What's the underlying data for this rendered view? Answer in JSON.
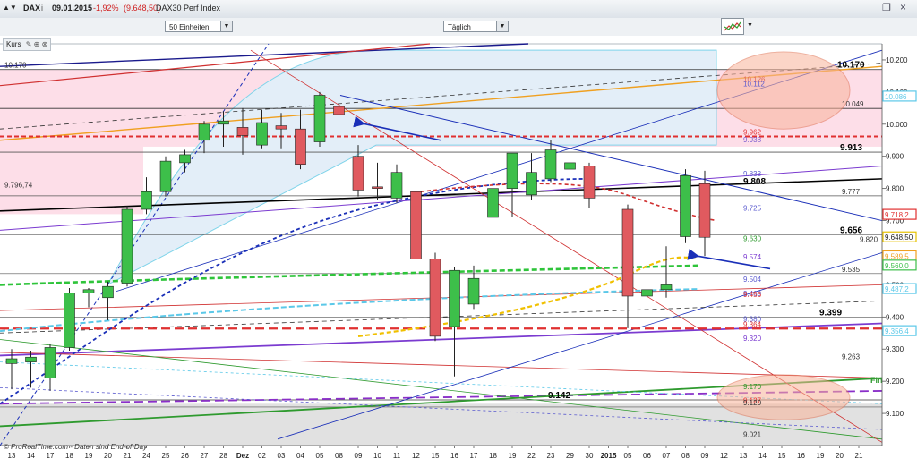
{
  "header": {
    "instrument_label": "DAX",
    "info_icon": "i",
    "date": "09.01.2015",
    "change": "-1,92%",
    "price": "(9.648,50)",
    "index_name": "DAX30 Perf Index"
  },
  "toolbar": {
    "units_select": "50 Einheiten",
    "interval_select": "Täglich",
    "panel_label": "Kurs"
  },
  "footer": {
    "copyright": "© ProRealTime.com - Daten sind End-of-Day"
  },
  "colors": {
    "bull": "#3dbf4a",
    "bear": "#e05a5f",
    "pink_zone": "#fcd3e0",
    "blue_zone": "#e3eef8",
    "ellipse": "#f9b49a"
  },
  "chart_data": {
    "type": "candlestick",
    "title": "DAX30 Perf Index",
    "ylim": [
      9000,
      10250
    ],
    "y_ticks": [
      9100,
      9200,
      9300,
      9400,
      9500,
      9600,
      9700,
      9800,
      9900,
      10000,
      10100,
      10200
    ],
    "y_tick_labels": [
      "9.100",
      "9.200",
      "9.300",
      "9.400",
      "9.500",
      "9.600",
      "9.700",
      "9.800",
      "9.900",
      "10.000",
      "10.100",
      "10.200"
    ],
    "x_labels": [
      "13",
      "14",
      "17",
      "18",
      "19",
      "20",
      "21",
      "24",
      "25",
      "26",
      "27",
      "28",
      "Dez",
      "02",
      "03",
      "04",
      "05",
      "08",
      "09",
      "10",
      "11",
      "12",
      "15",
      "16",
      "17",
      "18",
      "19",
      "22",
      "23",
      "29",
      "30",
      "2015",
      "05",
      "06",
      "07",
      "08",
      "09",
      "12",
      "13",
      "14",
      "15",
      "16",
      "19",
      "20",
      "21"
    ],
    "candles": [
      {
        "o": 9255,
        "h": 9300,
        "l": 9175,
        "c": 9270
      },
      {
        "o": 9260,
        "h": 9295,
        "l": 9180,
        "c": 9275
      },
      {
        "o": 9210,
        "h": 9315,
        "l": 9170,
        "c": 9305
      },
      {
        "o": 9305,
        "h": 9490,
        "l": 9295,
        "c": 9475
      },
      {
        "o": 9475,
        "h": 9490,
        "l": 9430,
        "c": 9485
      },
      {
        "o": 9460,
        "h": 9510,
        "l": 9390,
        "c": 9495
      },
      {
        "o": 9505,
        "h": 9745,
        "l": 9495,
        "c": 9735
      },
      {
        "o": 9735,
        "h": 9835,
        "l": 9720,
        "c": 9790
      },
      {
        "o": 9790,
        "h": 9900,
        "l": 9775,
        "c": 9885
      },
      {
        "o": 9880,
        "h": 9920,
        "l": 9850,
        "c": 9905
      },
      {
        "o": 9950,
        "h": 10010,
        "l": 9910,
        "c": 10000
      },
      {
        "o": 10000,
        "h": 10040,
        "l": 9930,
        "c": 10010
      },
      {
        "o": 9990,
        "h": 10050,
        "l": 9905,
        "c": 9965
      },
      {
        "o": 9935,
        "h": 10045,
        "l": 9925,
        "c": 10005
      },
      {
        "o": 9995,
        "h": 10035,
        "l": 9925,
        "c": 9985
      },
      {
        "o": 9985,
        "h": 10045,
        "l": 9860,
        "c": 9875
      },
      {
        "o": 9945,
        "h": 10100,
        "l": 9930,
        "c": 10090
      },
      {
        "o": 10055,
        "h": 10085,
        "l": 10010,
        "c": 10030
      },
      {
        "o": 9900,
        "h": 9935,
        "l": 9775,
        "c": 9795
      },
      {
        "o": 9805,
        "h": 9880,
        "l": 9765,
        "c": 9800
      },
      {
        "o": 9770,
        "h": 9875,
        "l": 9755,
        "c": 9850
      },
      {
        "o": 9790,
        "h": 9805,
        "l": 9570,
        "c": 9580
      },
      {
        "o": 9580,
        "h": 9600,
        "l": 9325,
        "c": 9340
      },
      {
        "o": 9370,
        "h": 9555,
        "l": 9215,
        "c": 9545
      },
      {
        "o": 9440,
        "h": 9560,
        "l": 9425,
        "c": 9520
      },
      {
        "o": 9710,
        "h": 9840,
        "l": 9685,
        "c": 9800
      },
      {
        "o": 9800,
        "h": 9910,
        "l": 9710,
        "c": 9910
      },
      {
        "o": 9780,
        "h": 9910,
        "l": 9765,
        "c": 9850
      },
      {
        "o": 9830,
        "h": 9950,
        "l": 9820,
        "c": 9920
      },
      {
        "o": 9860,
        "h": 9925,
        "l": 9845,
        "c": 9880
      },
      {
        "o": 9870,
        "h": 9880,
        "l": 9740,
        "c": 9770
      },
      {
        "o": 9735,
        "h": 9750,
        "l": 9365,
        "c": 9465
      },
      {
        "o": 9465,
        "h": 9615,
        "l": 9380,
        "c": 9485
      },
      {
        "o": 9485,
        "h": 9620,
        "l": 9460,
        "c": 9500
      },
      {
        "o": 9650,
        "h": 9860,
        "l": 9630,
        "c": 9840
      },
      {
        "o": 9815,
        "h": 9855,
        "l": 9590,
        "c": 9648
      }
    ],
    "candle_slots": [
      0,
      1,
      2,
      3,
      4,
      5,
      6,
      7,
      8,
      9,
      10,
      11,
      12,
      13,
      14,
      15,
      16,
      17,
      18,
      19,
      20,
      21,
      22,
      23,
      24,
      25,
      26,
      27,
      28,
      29,
      30,
      32,
      33,
      34,
      35,
      36
    ],
    "price_labels": [
      {
        "text": "10.170",
        "y": 10170,
        "color": "#000000",
        "bold": true
      },
      {
        "text": "10.126",
        "y": 10126,
        "color": "#e06b5a",
        "bold": false
      },
      {
        "text": "10.112",
        "y": 10112,
        "color": "#5b5bcf",
        "bold": false
      },
      {
        "text": "10.049",
        "y": 10049,
        "color": "#333333",
        "bold": false
      },
      {
        "text": "9.962",
        "y": 9962,
        "color": "#e03030",
        "bold": false
      },
      {
        "text": "9.938",
        "y": 9938,
        "color": "#7b5bd0",
        "bold": false
      },
      {
        "text": "9.913",
        "y": 9913,
        "color": "#000000",
        "bold": true
      },
      {
        "text": "9.833",
        "y": 9833,
        "color": "#5b5bcf",
        "bold": false
      },
      {
        "text": "9.808",
        "y": 9808,
        "color": "#000000",
        "bold": true
      },
      {
        "text": "9.777",
        "y": 9777,
        "color": "#333333",
        "bold": false
      },
      {
        "text": "9.725",
        "y": 9725,
        "color": "#5b5bcf",
        "bold": false
      },
      {
        "text": "9.656",
        "y": 9656,
        "color": "#000000",
        "bold": true
      },
      {
        "text": "9.630",
        "y": 9630,
        "color": "#2e9a2e",
        "bold": false
      },
      {
        "text": "9.574",
        "y": 9574,
        "color": "#7b3bd0",
        "bold": false
      },
      {
        "text": "9.535",
        "y": 9535,
        "color": "#333333",
        "bold": false
      },
      {
        "text": "9.504",
        "y": 9504,
        "color": "#5b5bcf",
        "bold": false
      },
      {
        "text": "9.460",
        "y": 9460,
        "color": "#5b5bcf",
        "bold": false
      },
      {
        "text": "9.456",
        "y": 9456,
        "color": "#e03030",
        "bold": false
      },
      {
        "text": "9.399",
        "y": 9399,
        "color": "#000000",
        "bold": true
      },
      {
        "text": "9.380",
        "y": 9380,
        "color": "#5b5bcf",
        "bold": false
      },
      {
        "text": "9.364",
        "y": 9364,
        "color": "#e03030",
        "bold": false
      },
      {
        "text": "9.320",
        "y": 9320,
        "color": "#7b3bd0",
        "bold": false
      },
      {
        "text": "9.263",
        "y": 9263,
        "color": "#333333",
        "bold": false
      },
      {
        "text": "9.170",
        "y": 9170,
        "color": "#2e9a2e",
        "bold": false
      },
      {
        "text": "9.142",
        "y": 9142,
        "color": "#000000",
        "bold": true
      },
      {
        "text": "9.127",
        "y": 9127,
        "color": "#e03030",
        "bold": false
      },
      {
        "text": "9.120",
        "y": 9120,
        "color": "#333333",
        "bold": false
      },
      {
        "text": "9.021",
        "y": 9021,
        "color": "#333333",
        "bold": false
      },
      {
        "text": "9.820",
        "y": 9628,
        "color": "#333333",
        "bold": false
      },
      {
        "text": "9.796,74",
        "y": 9797,
        "color": "#333333",
        "bold": false
      },
      {
        "text": "10.170",
        "y": 10170,
        "color": "#333333",
        "bold": false
      }
    ],
    "axis_badges": [
      {
        "text": "10.086",
        "y": 10086,
        "color": "#5bc8e8"
      },
      {
        "text": "9.718,2",
        "y": 9718,
        "color": "#e03030"
      },
      {
        "text": "9.648,50",
        "y": 9648,
        "color": "#e6c200"
      },
      {
        "text": "9.589,5",
        "y": 9589,
        "color": "#f0a020"
      },
      {
        "text": "9.560,0",
        "y": 9560,
        "color": "#3dbf4a"
      },
      {
        "text": "9.487,2",
        "y": 9487,
        "color": "#5bc8e8"
      },
      {
        "text": "9.356,4",
        "y": 9356,
        "color": "#5bc8e8"
      }
    ],
    "annotations": [
      {
        "text": "Fin",
        "y": 9195,
        "color": "#2e9a2e"
      }
    ]
  }
}
